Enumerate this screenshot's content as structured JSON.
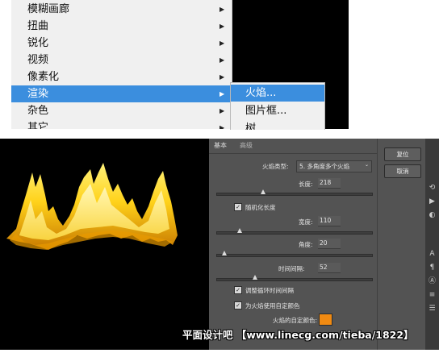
{
  "menu": {
    "items": [
      {
        "label": "模糊画廊",
        "arrow": "▶"
      },
      {
        "label": "扭曲",
        "arrow": "▶"
      },
      {
        "label": "锐化",
        "arrow": "▶"
      },
      {
        "label": "视频",
        "arrow": "▶"
      },
      {
        "label": "像素化",
        "arrow": "▶"
      },
      {
        "label": "渲染",
        "arrow": "▶"
      },
      {
        "label": "杂色",
        "arrow": "▶"
      },
      {
        "label": "其它",
        "arrow": "▶"
      }
    ],
    "highlighted": "渲染"
  },
  "submenu": {
    "items": [
      {
        "label": "火焰..."
      },
      {
        "label": "图片框..."
      },
      {
        "label": "树"
      }
    ]
  },
  "dialog": {
    "tabs": {
      "basic": "基本",
      "advanced": "高级"
    },
    "flame_type": {
      "label": "火焰类型:",
      "value": "5. 多角度多个火焰"
    },
    "length": {
      "label": "长度:",
      "value": "218",
      "level": 0.3
    },
    "randomize_length": {
      "label": "随机化长度",
      "checked": true
    },
    "width": {
      "label": "宽度:",
      "value": "110",
      "level": 0.15
    },
    "angle": {
      "label": "角度:",
      "value": "20",
      "level": 0.05
    },
    "interval": {
      "label": "时间间隔:",
      "value": "52",
      "level": 0.25
    },
    "adjust_loop": {
      "label": "调整循环时间间隔",
      "checked": true
    },
    "custom_color": {
      "label": "为火焰使用自定颜色",
      "checked": true
    },
    "color_swatch_label": "火焰的自定颜色:",
    "color": "#f08a12",
    "buttons": {
      "reset": "复位",
      "cancel": "取消"
    }
  },
  "side_icons": [
    "rotate-icon",
    "play-icon",
    "adjust-icon",
    "text-icon",
    "paragraph-icon",
    "glyph-icon",
    "layers-icon",
    "properties-icon"
  ],
  "watermark": "平面设计吧 【www.linecg.com/tieba/1822】"
}
